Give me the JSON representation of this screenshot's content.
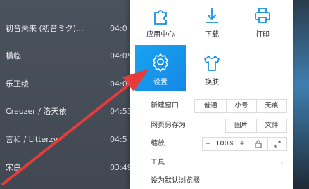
{
  "playlist": {
    "rows": [
      {
        "song": "初音未来 (初音ミク)...",
        "time": "04:0"
      },
      {
        "song": "横临",
        "time": "04:05"
      },
      {
        "song": "乐正绫",
        "time": "04:0"
      },
      {
        "song": "Creuzer / 洛天依",
        "time": "04:53"
      },
      {
        "song": "言和 / Litterzy",
        "time": "04:5"
      },
      {
        "song": "宋白",
        "time": "03:49"
      }
    ]
  },
  "menu": {
    "tiles": [
      {
        "label": "应用中心",
        "icon": "puzzle-icon"
      },
      {
        "label": "下载",
        "icon": "download-icon"
      },
      {
        "label": "打印",
        "icon": "printer-icon"
      },
      {
        "label": "设置",
        "icon": "gear-icon"
      },
      {
        "label": "换肤",
        "icon": "shirt-icon"
      }
    ],
    "new_window": {
      "label": "新建窗口",
      "options": [
        "普通",
        "小号",
        "无痕"
      ]
    },
    "save_as": {
      "label": "网页另存为",
      "options": [
        "图片",
        "文件"
      ]
    },
    "zoom": {
      "label": "缩放",
      "minus": "−",
      "value": "100%",
      "plus": "+"
    },
    "tools": {
      "label": "工具",
      "chevron": "›"
    },
    "default_browser": {
      "label": "设为默认浏览器"
    }
  },
  "colors": {
    "accent": "#1890e8",
    "annotation_arrow": "#e53b3b"
  }
}
